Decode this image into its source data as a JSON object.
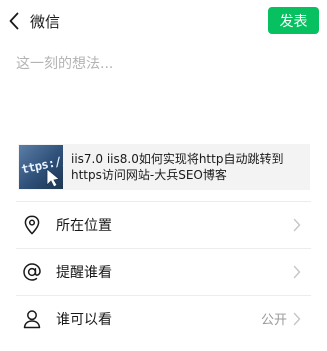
{
  "header": {
    "title": "微信",
    "publish_label": "发表"
  },
  "compose": {
    "placeholder": "这一刻的想法..."
  },
  "shared_link": {
    "thumbnail_text": "ttps://w",
    "title": "iis7.0 iis8.0如何实现将http自动跳转到https访问网站-大兵SEO博客"
  },
  "options": [
    {
      "label": "所在位置",
      "value": "",
      "icon": "location-pin-icon"
    },
    {
      "label": "提醒谁看",
      "value": "",
      "icon": "at-sign-icon"
    },
    {
      "label": "谁可以看",
      "value": "公开",
      "icon": "person-icon"
    }
  ],
  "colors": {
    "accent": "#07c160",
    "chevron": "#c8c8c8",
    "placeholder": "#b3b3b3"
  }
}
